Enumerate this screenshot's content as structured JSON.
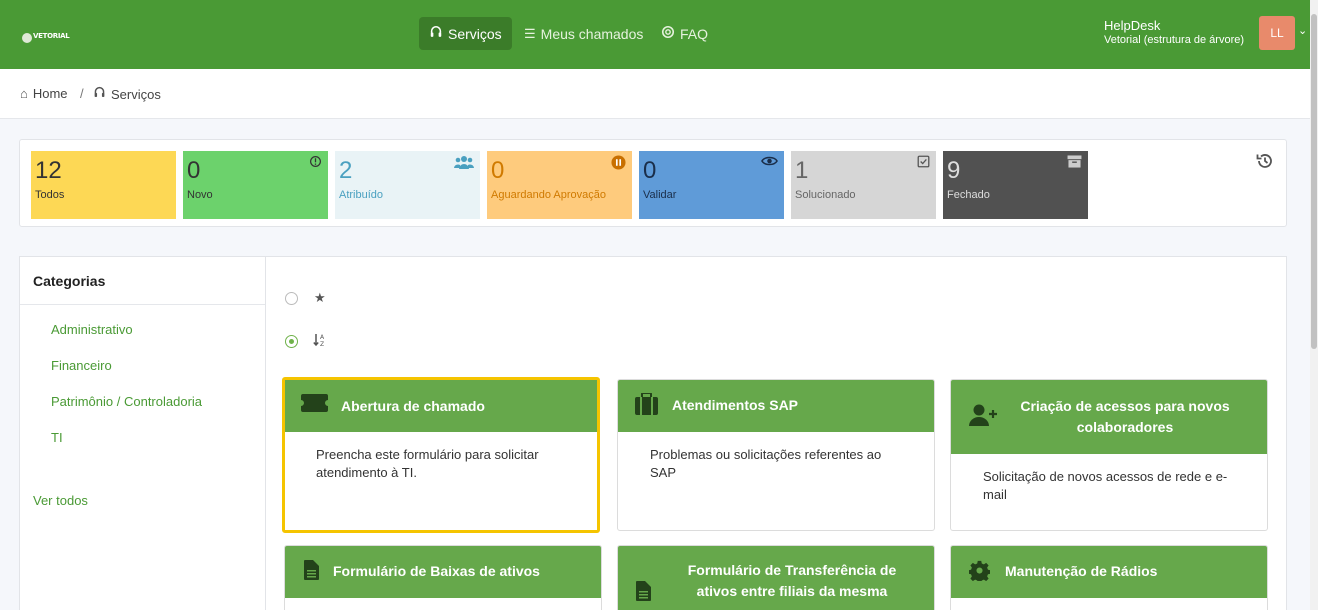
{
  "topbar": {
    "logo_text": "VETORIAL",
    "nav": [
      {
        "label": "Serviços",
        "icon": "headset-icon"
      },
      {
        "label": "Meus chamados",
        "icon": "list-icon"
      },
      {
        "label": "FAQ",
        "icon": "lifebuoy-icon"
      }
    ],
    "user_name": "HelpDesk",
    "user_entity": "Vetorial (estrutura de árvore)",
    "avatar_initials": "LL"
  },
  "breadcrumb": {
    "home": "Home",
    "separator": "/",
    "current": "Serviços"
  },
  "stats": [
    {
      "count": "12",
      "label": "Todos",
      "bg": "#fdd855",
      "color": "#333"
    },
    {
      "count": "0",
      "label": "Novo",
      "bg": "#6cd26c",
      "color": "#333"
    },
    {
      "count": "2",
      "label": "Atribuído",
      "bg": "#e9f3f6",
      "color": "#4aa0c0"
    },
    {
      "count": "0",
      "label": "Aguardando Aprovação",
      "bg": "#fecb7d",
      "color": "#d07a00"
    },
    {
      "count": "0",
      "label": "Validar",
      "bg": "#5f9bd8",
      "color": "#1a2e4a"
    },
    {
      "count": "1",
      "label": "Solucionado",
      "bg": "#d6d6d6",
      "color": "#666"
    },
    {
      "count": "9",
      "label": "Fechado",
      "bg": "#515151",
      "color": "#ddd"
    }
  ],
  "sidebar": {
    "title": "Categorias",
    "items": [
      "Administrativo",
      "Financeiro",
      "Patrimônio / Controladoria",
      "TI"
    ],
    "see_all": "Ver todos"
  },
  "cards": [
    {
      "title": "Abertura de chamado",
      "desc": "Preencha este formulário para solicitar atendimento à TI.",
      "icon": "ticket-icon"
    },
    {
      "title": "Atendimentos SAP",
      "desc": "Problemas ou solicitações referentes ao SAP",
      "icon": "suitcase-icon"
    },
    {
      "title": "Criação de acessos para novos colaboradores",
      "desc": "Solicitação de novos acessos de rede e e-mail",
      "icon": "user-plus-icon"
    },
    {
      "title": "Formulário de Baixas de ativos",
      "desc": "",
      "icon": "file-icon"
    },
    {
      "title": "Formulário de Transferência de ativos entre filiais da mesma",
      "desc": "",
      "icon": "file-icon"
    },
    {
      "title": "Manutenção de Rádios",
      "desc": "",
      "icon": "gear-icon"
    }
  ],
  "colors": {
    "brand": "#4a9a35",
    "card_header": "#66a84b",
    "selected_border": "#f5c400"
  }
}
